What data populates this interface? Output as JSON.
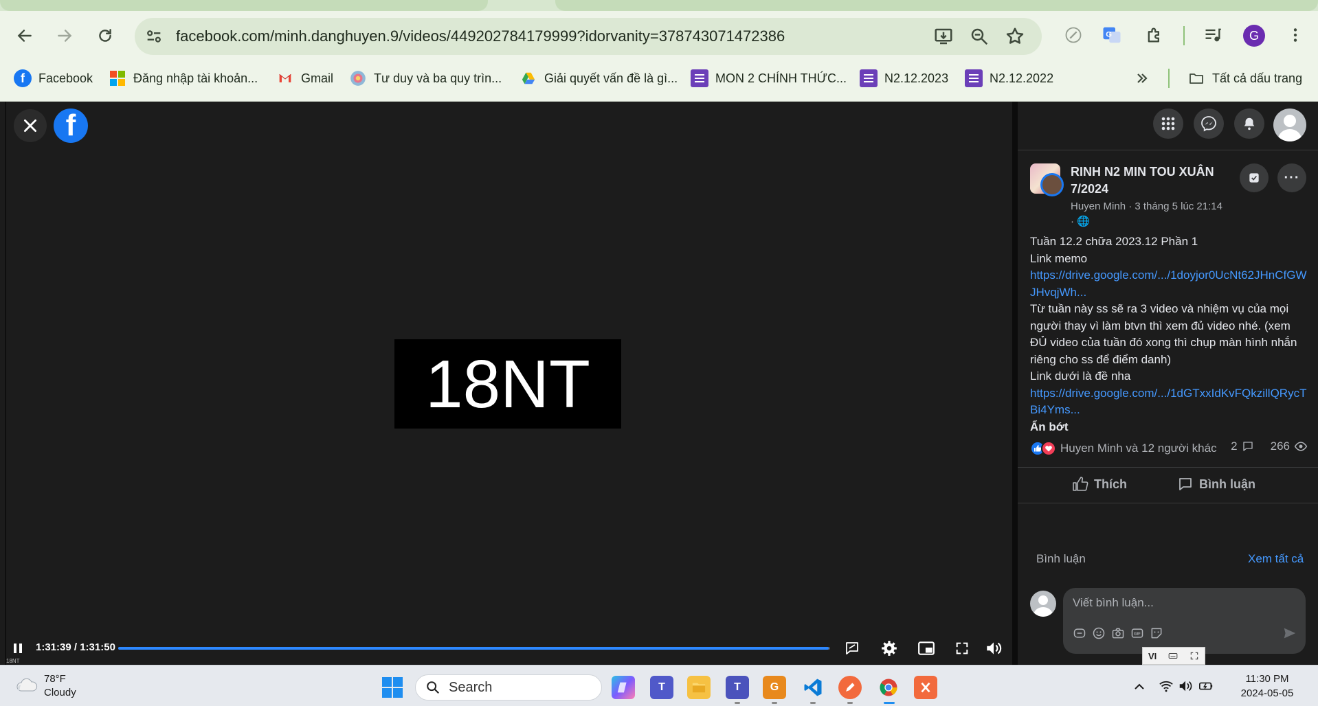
{
  "browser": {
    "url": "facebook.com/minh.danghuyen.9/videos/449202784179999?idorvanity=378743071472386",
    "profile_initial": "G",
    "bookmarks": [
      {
        "label": "Facebook",
        "icon": "facebook-icon"
      },
      {
        "label": "Đăng nhập tài khoản...",
        "icon": "microsoft-icon"
      },
      {
        "label": "Gmail",
        "icon": "gmail-icon"
      },
      {
        "label": "Tư duy và ba quy trìn...",
        "icon": "colorful-wheel-icon"
      },
      {
        "label": "Giải quyết vấn đề là gì...",
        "icon": "google-drive-icon"
      },
      {
        "label": "MON 2 CHÍNH THỨC...",
        "icon": "google-forms-icon"
      },
      {
        "label": "N2.12.2023",
        "icon": "google-forms-icon"
      },
      {
        "label": "N2.12.2022",
        "icon": "google-forms-icon"
      }
    ],
    "all_bookmarks_label": "Tất cả dấu trang"
  },
  "video": {
    "frame_text": "18NT",
    "time_current": "1:31:39",
    "time_total": "1:31:50",
    "timecode": "1:31:39 / 1:31:50",
    "progress": 0.998,
    "tiny_label": "18NT"
  },
  "post": {
    "group_name": "RINH N2 MIN TOU XUÂN 7/2024",
    "meta_line1": "Huyen Minh · 3 tháng 5 lúc 21:14",
    "meta_line2": "· 🌐",
    "body": [
      {
        "text": "Tuần 12.2 chữa 2023.12 Phần 1",
        "kind": "text"
      },
      {
        "text": "Link memo",
        "kind": "text"
      },
      {
        "text": "https://drive.google.com/.../1doyjor0UcNt62JHnCfGWJHvqjWh...",
        "kind": "link"
      },
      {
        "text": "Từ tuần này ss sẽ ra 3 video và nhiệm vụ của mọi người thay vì làm btvn thì xem đủ video nhé. (xem ĐỦ video của tuần đó xong thì chụp màn hình nhắn riêng cho ss để điểm danh)",
        "kind": "text"
      },
      {
        "text": "Link dưới là đề nha",
        "kind": "text"
      },
      {
        "text": "https://drive.google.com/.../1dGTxxIdKvFQkzillQRycTBi4Yms...",
        "kind": "link"
      },
      {
        "text": "Ẩn bớt",
        "kind": "bold"
      }
    ],
    "reactions_text": "Huyen Minh và 12 người khác",
    "comment_count": "2",
    "view_count": "266",
    "like_label": "Thích",
    "comment_label": "Bình luận"
  },
  "comments": {
    "title": "Bình luận",
    "see_all": "Xem tất cả",
    "placeholder": "Viết bình luận..."
  },
  "ime": {
    "lang": "VI"
  },
  "taskbar": {
    "temperature": "78°F",
    "condition": "Cloudy",
    "search_label": "Search",
    "time": "11:30 PM",
    "date": "2024-05-05"
  },
  "colors": {
    "facebook_blue": "#1877f2",
    "link": "#4599ff",
    "progress": "#2d88ff",
    "chrome_toolbar": "#eef4e9"
  }
}
